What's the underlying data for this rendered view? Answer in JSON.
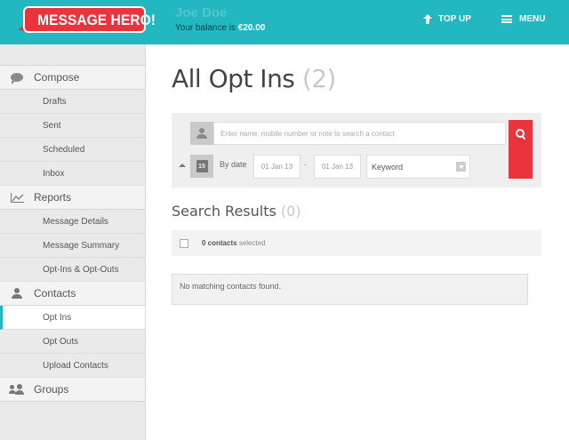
{
  "brand": {
    "logo_text": "MESSAGE HERO!",
    "primary_color": "#22b7c1",
    "accent_color": "#e8343a"
  },
  "header": {
    "account_name": "Joe Doe",
    "balance_label": "Your balance is",
    "balance_value": "€20.00",
    "topup_label": "TOP UP",
    "menu_label": "MENU"
  },
  "sidebar": {
    "sections": [
      {
        "label": "Compose",
        "icon": "compose-icon",
        "items": [
          "Drafts",
          "Sent",
          "Scheduled",
          "Inbox"
        ]
      },
      {
        "label": "Reports",
        "icon": "chart-icon",
        "items": [
          "Message Details",
          "Message Summary",
          "Opt-Ins & Opt-Outs"
        ]
      },
      {
        "label": "Contacts",
        "icon": "user-icon",
        "items": [
          "Opt Ins",
          "Opt Outs",
          "Upload Contacts"
        ]
      },
      {
        "label": "Groups",
        "icon": "groups-icon",
        "items": []
      }
    ],
    "active_item": "Opt Ins"
  },
  "main": {
    "title": "All Opt Ins",
    "title_count": "(2)",
    "search": {
      "placeholder": "Enter name, mobile number or note to search a contact",
      "by_date_label": "By date",
      "date_from": "01 Jan 13",
      "date_separator": "-",
      "date_to": "01 Jan 13",
      "calendar_day": "15",
      "keyword_selected": "Keyword"
    },
    "results": {
      "title": "Search Results",
      "count": "(0)",
      "selected_count": "0 contacts",
      "selected_suffix": "selected",
      "empty_message": "No matching contacts found."
    }
  }
}
